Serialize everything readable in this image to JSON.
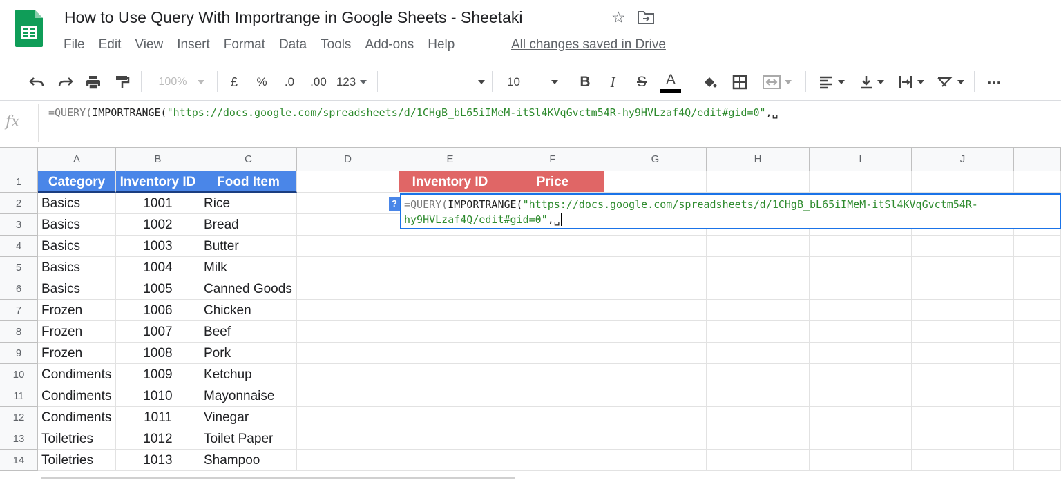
{
  "app": {
    "title": "How to Use Query With Importrange in Google Sheets - Sheetaki",
    "menu": [
      "File",
      "Edit",
      "View",
      "Insert",
      "Format",
      "Data",
      "Tools",
      "Add-ons",
      "Help"
    ],
    "save_status": "All changes saved in Drive",
    "brand_color": "#0f9d58"
  },
  "toolbar": {
    "zoom": "100%",
    "currency": "£",
    "percent": "%",
    "decrease_decimal": ".0",
    "increase_decimal": ".00",
    "more_formats": "123",
    "font_size": "10",
    "bold": "B",
    "italic": "I",
    "strikethrough": "S",
    "text_color": "A",
    "more": "⋯",
    "icons": [
      "undo-icon",
      "redo-icon",
      "print-icon",
      "paint-format-icon",
      "fill-color-icon",
      "borders-icon",
      "merge-icon",
      "align-left-icon",
      "valign-icon",
      "text-wrap-icon",
      "text-rotate-icon"
    ]
  },
  "formula_bar": {
    "prefix": "=QUERY(",
    "fn2": "IMPORTRANGE(",
    "str": "\"https://docs.google.com/spreadsheets/d/1CHgB_bL65iIMeM-itSl4KVqGvctm54R-hy9HVLzaf4Q/edit#gid=0\"",
    "suffix": ",␣"
  },
  "editor": {
    "help": "?",
    "prefix": "=QUERY(",
    "fn2": "IMPORTRANGE(",
    "str_line1": "\"https://docs.google.com/spreadsheets/d/1CHgB_bL65iIMeM-itSl4KVqGvctm54R-",
    "str_line2": "hy9HVLzaf4Q/edit#gid=0\"",
    "suffix": ",␣"
  },
  "columns": [
    "A",
    "B",
    "C",
    "D",
    "E",
    "F",
    "G",
    "H",
    "I",
    "J"
  ],
  "rows": [
    "1",
    "2",
    "3",
    "4",
    "5",
    "6",
    "7",
    "8",
    "9",
    "10",
    "11",
    "12",
    "13",
    "14"
  ],
  "headers_left": [
    "Category",
    "Inventory ID",
    "Food Item"
  ],
  "headers_right": [
    "Inventory ID",
    "Price"
  ],
  "header_colors": {
    "left": "#4a86e8",
    "right": "#e06666"
  },
  "data": [
    [
      "Basics",
      "1001",
      "Rice"
    ],
    [
      "Basics",
      "1002",
      "Bread"
    ],
    [
      "Basics",
      "1003",
      "Butter"
    ],
    [
      "Basics",
      "1004",
      "Milk"
    ],
    [
      "Basics",
      "1005",
      "Canned Goods"
    ],
    [
      "Frozen",
      "1006",
      "Chicken"
    ],
    [
      "Frozen",
      "1007",
      "Beef"
    ],
    [
      "Frozen",
      "1008",
      "Pork"
    ],
    [
      "Condiments",
      "1009",
      "Ketchup"
    ],
    [
      "Condiments",
      "1010",
      "Mayonnaise"
    ],
    [
      "Condiments",
      "1011",
      "Vinegar"
    ],
    [
      "Toiletries",
      "1012",
      "Toilet Paper"
    ],
    [
      "Toiletries",
      "1013",
      "Shampoo"
    ]
  ]
}
